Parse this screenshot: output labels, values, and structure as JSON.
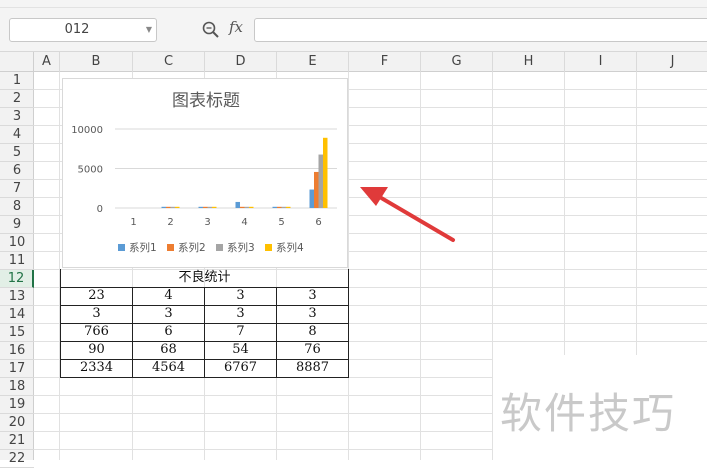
{
  "toolbar": {
    "namebox_value": "012",
    "fx_label": "fx",
    "formula_value": ""
  },
  "columns": [
    "A",
    "B",
    "C",
    "D",
    "E",
    "F",
    "G",
    "H",
    "I",
    "J"
  ],
  "rows": [
    "1",
    "2",
    "3",
    "4",
    "5",
    "6",
    "7",
    "8",
    "9",
    "10",
    "11",
    "12",
    "13",
    "14",
    "15",
    "16",
    "17",
    "18",
    "19",
    "20",
    "21",
    "22"
  ],
  "active_row": "12",
  "table": {
    "title": "不良统计",
    "rows": [
      [
        "23",
        "4",
        "3",
        "3"
      ],
      [
        "3",
        "3",
        "3",
        "3"
      ],
      [
        "766",
        "6",
        "7",
        "8"
      ],
      [
        "90",
        "68",
        "54",
        "76"
      ],
      [
        "2334",
        "4564",
        "6767",
        "8887"
      ]
    ]
  },
  "chart_data": {
    "type": "bar",
    "title": "图表标题",
    "categories": [
      "1",
      "2",
      "3",
      "4",
      "5",
      "6"
    ],
    "ylim": [
      0,
      10000
    ],
    "yticks": [
      "0",
      "5000",
      "10000"
    ],
    "legend_position": "bottom",
    "grid": true,
    "series": [
      {
        "name": "系列1",
        "color": "#5b9bd5",
        "values": [
          23,
          3,
          766,
          90,
          2334
        ]
      },
      {
        "name": "系列2",
        "color": "#ed7d31",
        "values": [
          4,
          3,
          6,
          68,
          4564
        ]
      },
      {
        "name": "系列3",
        "color": "#a5a5a5",
        "values": [
          3,
          3,
          7,
          54,
          6767
        ]
      },
      {
        "name": "系列4",
        "color": "#ffc000",
        "values": [
          3,
          3,
          8,
          76,
          8887
        ]
      }
    ]
  },
  "watermark": "软件技巧",
  "colors": {
    "arrow": "#e03a3a",
    "active_row": "#217346"
  }
}
